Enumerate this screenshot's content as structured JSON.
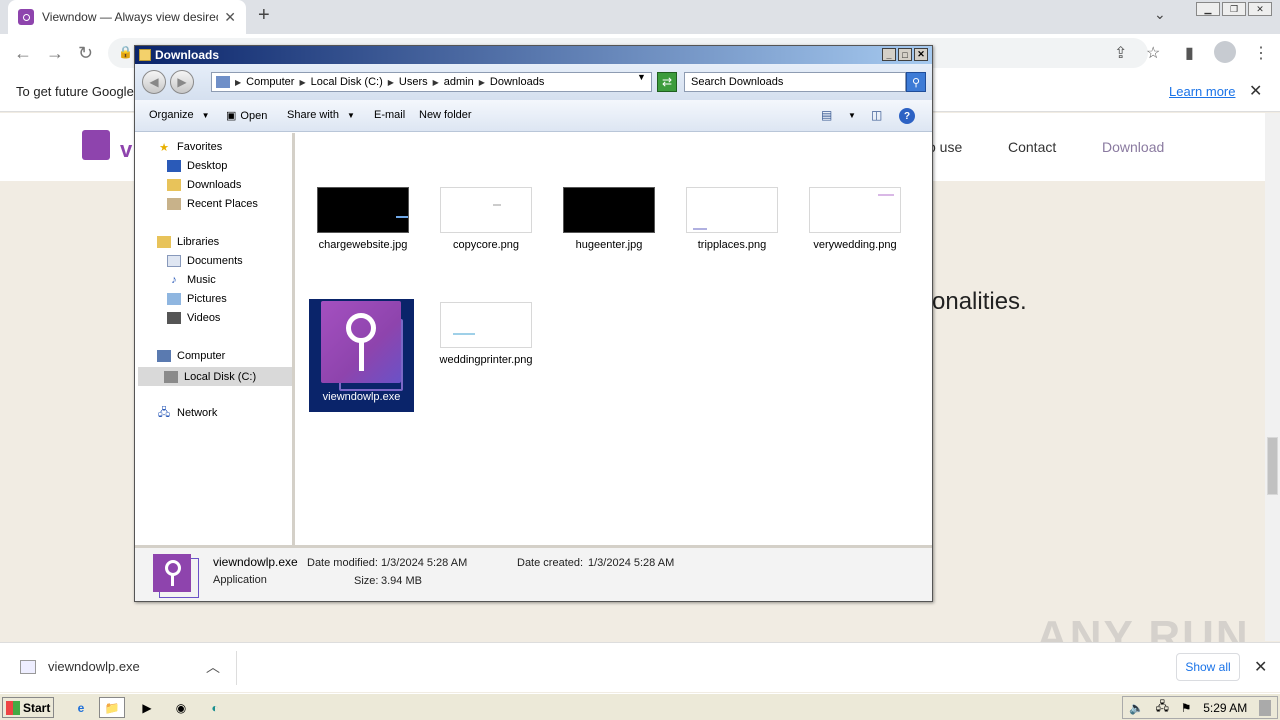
{
  "browser": {
    "tab_title": "Viewndow — Always view desired wi",
    "tab_close": "✕",
    "new_tab": "+",
    "infobar_message": "To get future Google",
    "infobar_learn_more": "Learn more",
    "infobar_close": "✕"
  },
  "website": {
    "logo_letter": "v",
    "nav": [
      "o use",
      "Contact",
      "Download"
    ],
    "body_fragment": "tionalities.",
    "watermark": "ANY RUN"
  },
  "download_bar": {
    "file_name": "viewndowlp.exe",
    "show_all": "Show all"
  },
  "taskbar": {
    "start_label": "Start",
    "clock": "5:29 AM"
  },
  "explorer": {
    "title": "Downloads",
    "breadcrumb": [
      "Computer",
      "Local Disk (C:)",
      "Users",
      "admin",
      "Downloads"
    ],
    "search_placeholder": "Search Downloads",
    "commands": [
      "Organize",
      "Open",
      "Share with",
      "E-mail",
      "New folder"
    ],
    "nav": {
      "favorites": "Favorites",
      "desktop": "Desktop",
      "downloads": "Downloads",
      "recent": "Recent Places",
      "libraries": "Libraries",
      "documents": "Documents",
      "music": "Music",
      "pictures": "Pictures",
      "videos": "Videos",
      "computer": "Computer",
      "local_disk": "Local Disk (C:)",
      "network": "Network"
    },
    "files": [
      {
        "name": "chargewebsite.jpg",
        "thumb": "black"
      },
      {
        "name": "copycore.png",
        "thumb": "white"
      },
      {
        "name": "hugeenter.jpg",
        "thumb": "black"
      },
      {
        "name": "tripplaces.png",
        "thumb": "white"
      },
      {
        "name": "verywedding.png",
        "thumb": "white"
      },
      {
        "name": "viewndowlp.exe",
        "thumb": "exe",
        "selected": true
      },
      {
        "name": "weddingprinter.png",
        "thumb": "white"
      }
    ],
    "details": {
      "name": "viewndowlp.exe",
      "type": "Application",
      "date_modified_label": "Date modified:",
      "date_modified": "1/3/2024 5:28 AM",
      "date_created_label": "Date created:",
      "date_created": "1/3/2024 5:28 AM",
      "size_label": "Size:",
      "size": "3.94 MB"
    }
  },
  "colors": {
    "brand_purple": "#8e44ad",
    "selection_blue": "#0a246a",
    "link_blue": "#1a73e8"
  }
}
